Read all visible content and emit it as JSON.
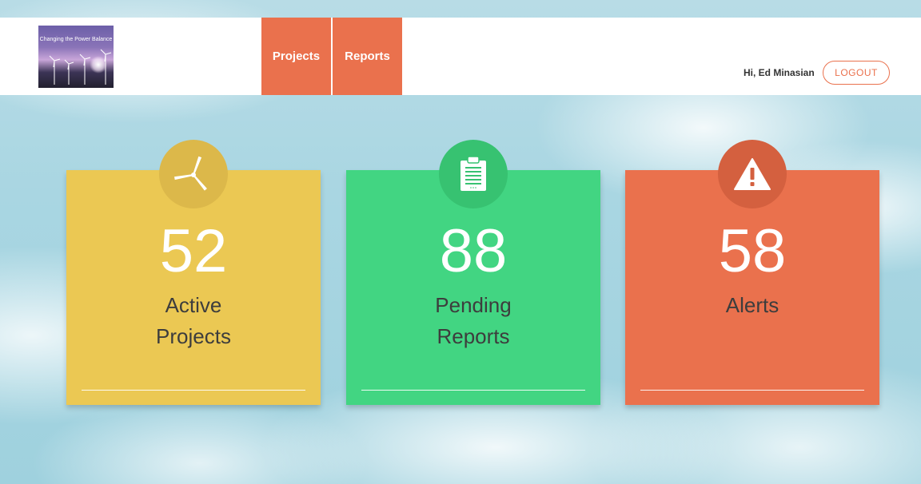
{
  "header": {
    "logo_text": "Changing the Power Balance",
    "nav": [
      {
        "label": "Projects"
      },
      {
        "label": "Reports"
      }
    ],
    "greeting": "Hi, Ed Minasian",
    "logout_label": "LOGOUT"
  },
  "cards": [
    {
      "value": "52",
      "label_line1": "Active",
      "label_line2": "Projects",
      "icon": "wind-turbine-icon",
      "color": "#ebc853"
    },
    {
      "value": "88",
      "label_line1": "Pending",
      "label_line2": "Reports",
      "icon": "clipboard-icon",
      "color": "#42d582"
    },
    {
      "value": "58",
      "label_line1": "Alerts",
      "label_line2": "",
      "icon": "warning-icon",
      "color": "#ea714d"
    }
  ],
  "colors": {
    "accent": "#ea714d",
    "yellow": "#ebc853",
    "green": "#42d582"
  }
}
